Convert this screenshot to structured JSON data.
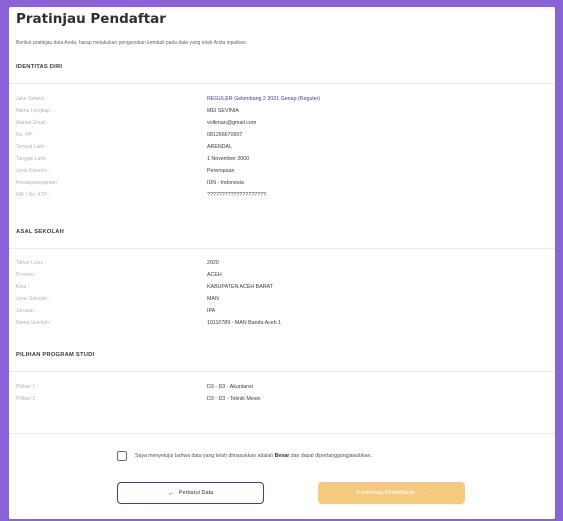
{
  "title": "Pratinjau Pendaftar",
  "subtitle": "Berikut pratinjau data Anda, harap melakukan pengecekan kembali pada data yang telah Anda inputkan.",
  "sections": {
    "identitas": {
      "heading": "IDENTITAS DIRI",
      "rows": [
        {
          "label": "Jalur Seleksi :",
          "value": "REGULER Gelombang 2 2021 Genap (Reguler)"
        },
        {
          "label": "Nama Lengkap :",
          "value": "MEI SEVINIA"
        },
        {
          "label": "Alamat Email :",
          "value": "volkman@gmail.com"
        },
        {
          "label": "No. HP :",
          "value": "081266670907"
        },
        {
          "label": "Tempat Lahir :",
          "value": "ARENDAL"
        },
        {
          "label": "Tanggal Lahir :",
          "value": "1 November 2000"
        },
        {
          "label": "Jenis Kelamin :",
          "value": "Perempuan"
        },
        {
          "label": "Kewarganegaraan :",
          "value": "IDN - Indonesia"
        },
        {
          "label": "NIK / No. KTP :",
          "value": "????????????????????"
        }
      ]
    },
    "sekolah": {
      "heading": "ASAL SEKOLAH",
      "rows": [
        {
          "label": "Tahun Lulus :",
          "value": "2020"
        },
        {
          "label": "Provinsi :",
          "value": "ACEH"
        },
        {
          "label": "Kota :",
          "value": "KABUPATEN ACEH BARAT"
        },
        {
          "label": "Jenis Sekolah :",
          "value": "MAN"
        },
        {
          "label": "Jurusan :",
          "value": "IPA"
        },
        {
          "label": "Nama Sekolah :",
          "value": "10110789 - MAN Banda Aceh 1"
        }
      ]
    },
    "prodi": {
      "heading": "PILIHAN PROGRAM STUDI",
      "rows": [
        {
          "label": "Pilihan 1 :",
          "value": "D3 - D3 - Akuntansi"
        },
        {
          "label": "Pilihan 2 :",
          "value": "D3 - D3 - Teknik Mesin"
        }
      ]
    }
  },
  "agreement": {
    "before": "Saya menyetujui bahwa data yang telah dimasukkan adalah ",
    "bold": "Benar",
    "after": " dan dapat dipertanggungjawabkan."
  },
  "buttons": {
    "back_arrow": "←",
    "back_label": "Perbarui Data",
    "confirm_label": "Konfirmasi Pendaftaran",
    "confirm_arrow": "→"
  },
  "colors": {
    "background": "#8a64d6",
    "link": "#3f3fa8",
    "confirm": "#f5c97f",
    "back_border": "#3f3f8f"
  }
}
